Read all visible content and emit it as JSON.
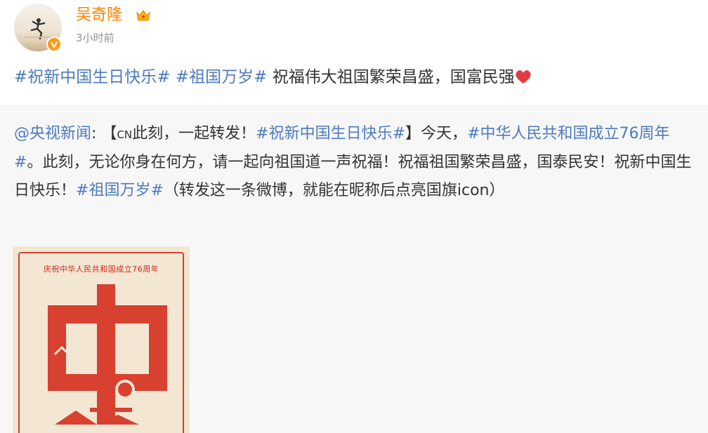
{
  "user": {
    "name": "吴奇隆",
    "time": "3小时前",
    "badges": [
      "crown-icon",
      "verified-icon"
    ]
  },
  "post": {
    "topic1": "#祝新中国生日快乐#",
    "topic2": "#祖国万岁#",
    "text": "祝福伟大祖国繁荣昌盛，国富民强",
    "emoji": "heart-icon"
  },
  "repost": {
    "author": "@央视新闻",
    "colon": ":",
    "bracket_open": "【",
    "cn_badge": "CN",
    "lead": "此刻，一起转发！",
    "topic_bday": "#祝新中国生日快乐#",
    "bracket_close": "】今天，",
    "topic_76": "#中华人民共和国成立76周年#",
    "body": "。此刻，无论你身在何方，请一起向祖国道一声祝福！祝福祖国繁荣昌盛，国泰民安！祝新中国生日快乐！",
    "topic_wansui": "#祖国万岁#",
    "tail": "（转发这一条微博，就能在昵称后点亮国旗icon）"
  },
  "poster": {
    "caption": "庆祝中华人民共和国成立76周年",
    "colors": {
      "red": "#d8402f",
      "paper": "#f3e6d3"
    }
  }
}
